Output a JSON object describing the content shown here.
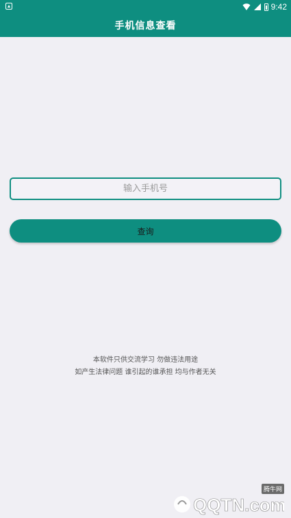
{
  "status_bar": {
    "time": "9:42"
  },
  "app_bar": {
    "title": "手机信息查看"
  },
  "form": {
    "phone_placeholder": "输入手机号",
    "phone_value": "",
    "query_label": "查询"
  },
  "disclaimer": {
    "line1": "本软件只供交流学习 勿做违法用途",
    "line2": "如产生法律问题 谁引起的谁承担 均与作者无关"
  },
  "watermark": {
    "badge": "腾牛网",
    "logo_text": "QQTN.com"
  },
  "colors": {
    "primary": "#0e8e80",
    "background": "#f0eff4",
    "caret": "#e91e63"
  }
}
